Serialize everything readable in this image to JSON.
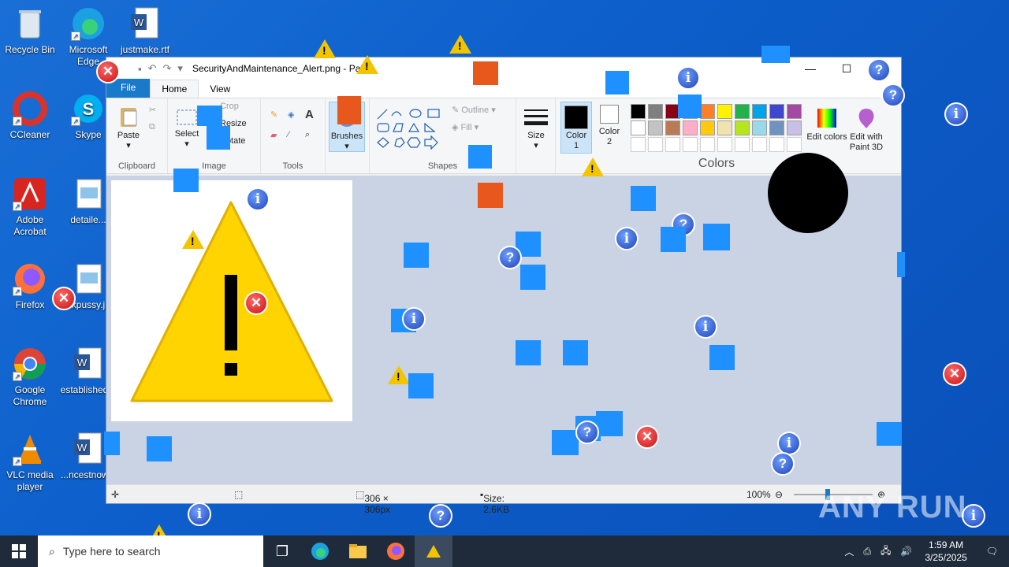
{
  "desktop": {
    "icons": [
      {
        "label": "Recycle Bin"
      },
      {
        "label": "Microsoft Edge"
      },
      {
        "label": "justmake.rtf"
      },
      {
        "label": "CCleaner"
      },
      {
        "label": "Skype"
      },
      {
        "label": "Adobe Acrobat"
      },
      {
        "label": "detaile..."
      },
      {
        "label": "Firefox"
      },
      {
        "label": "...kpussy.j..."
      },
      {
        "label": "Google Chrome"
      },
      {
        "label": "established..."
      },
      {
        "label": "VLC media player"
      },
      {
        "label": "...ncestnow..."
      }
    ]
  },
  "paint": {
    "title": "SecurityAndMaintenance_Alert.png - Paint",
    "tabs": [
      "File",
      "Home",
      "View"
    ],
    "ribbon": {
      "clipboard": {
        "paste": "Paste",
        "group": "Clipboard"
      },
      "image": {
        "select": "Select",
        "crop": "Crop",
        "resize": "Resize",
        "rotate": "Rotate",
        "group": "Image"
      },
      "tools": {
        "group": "Tools"
      },
      "brushes": {
        "label": "Brushes"
      },
      "shapes": {
        "outline": "Outline",
        "fill": "Fill",
        "group": "Shapes"
      },
      "size": {
        "label": "Size"
      },
      "color1": {
        "label": "Color 1"
      },
      "color2": {
        "label": "Color 2"
      },
      "colors": {
        "group": "Colors",
        "edit": "Edit colors",
        "paint3d": "Edit with Paint 3D"
      }
    },
    "palette_row1": [
      "#000000",
      "#7f7f7f",
      "#880015",
      "#ed1c24",
      "#ff7f27",
      "#fff200",
      "#22b14c",
      "#00a2e8",
      "#3f48cc",
      "#a349a4"
    ],
    "palette_row2": [
      "#ffffff",
      "#c3c3c3",
      "#b97a57",
      "#ffaec9",
      "#ffc90e",
      "#efe4b0",
      "#b5e61d",
      "#99d9ea",
      "#7092be",
      "#c8bfe7"
    ],
    "status": {
      "dimensions": "306 × 306px",
      "size": "Size: 2.6KB",
      "zoom": "100%"
    }
  },
  "taskbar": {
    "search_placeholder": "Type here to search",
    "time": "1:59 AM",
    "date": "3/25/2025"
  },
  "watermark": "ANY RUN"
}
